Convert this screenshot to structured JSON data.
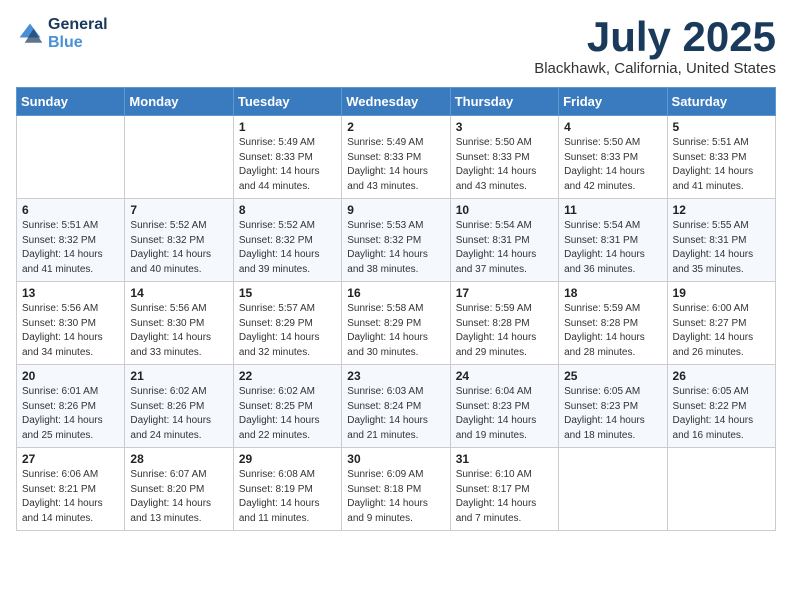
{
  "header": {
    "logo_line1": "General",
    "logo_line2": "Blue",
    "month": "July 2025",
    "location": "Blackhawk, California, United States"
  },
  "weekdays": [
    "Sunday",
    "Monday",
    "Tuesday",
    "Wednesday",
    "Thursday",
    "Friday",
    "Saturday"
  ],
  "weeks": [
    [
      {
        "day": "",
        "info": ""
      },
      {
        "day": "",
        "info": ""
      },
      {
        "day": "1",
        "info": "Sunrise: 5:49 AM\nSunset: 8:33 PM\nDaylight: 14 hours and 44 minutes."
      },
      {
        "day": "2",
        "info": "Sunrise: 5:49 AM\nSunset: 8:33 PM\nDaylight: 14 hours and 43 minutes."
      },
      {
        "day": "3",
        "info": "Sunrise: 5:50 AM\nSunset: 8:33 PM\nDaylight: 14 hours and 43 minutes."
      },
      {
        "day": "4",
        "info": "Sunrise: 5:50 AM\nSunset: 8:33 PM\nDaylight: 14 hours and 42 minutes."
      },
      {
        "day": "5",
        "info": "Sunrise: 5:51 AM\nSunset: 8:33 PM\nDaylight: 14 hours and 41 minutes."
      }
    ],
    [
      {
        "day": "6",
        "info": "Sunrise: 5:51 AM\nSunset: 8:32 PM\nDaylight: 14 hours and 41 minutes."
      },
      {
        "day": "7",
        "info": "Sunrise: 5:52 AM\nSunset: 8:32 PM\nDaylight: 14 hours and 40 minutes."
      },
      {
        "day": "8",
        "info": "Sunrise: 5:52 AM\nSunset: 8:32 PM\nDaylight: 14 hours and 39 minutes."
      },
      {
        "day": "9",
        "info": "Sunrise: 5:53 AM\nSunset: 8:32 PM\nDaylight: 14 hours and 38 minutes."
      },
      {
        "day": "10",
        "info": "Sunrise: 5:54 AM\nSunset: 8:31 PM\nDaylight: 14 hours and 37 minutes."
      },
      {
        "day": "11",
        "info": "Sunrise: 5:54 AM\nSunset: 8:31 PM\nDaylight: 14 hours and 36 minutes."
      },
      {
        "day": "12",
        "info": "Sunrise: 5:55 AM\nSunset: 8:31 PM\nDaylight: 14 hours and 35 minutes."
      }
    ],
    [
      {
        "day": "13",
        "info": "Sunrise: 5:56 AM\nSunset: 8:30 PM\nDaylight: 14 hours and 34 minutes."
      },
      {
        "day": "14",
        "info": "Sunrise: 5:56 AM\nSunset: 8:30 PM\nDaylight: 14 hours and 33 minutes."
      },
      {
        "day": "15",
        "info": "Sunrise: 5:57 AM\nSunset: 8:29 PM\nDaylight: 14 hours and 32 minutes."
      },
      {
        "day": "16",
        "info": "Sunrise: 5:58 AM\nSunset: 8:29 PM\nDaylight: 14 hours and 30 minutes."
      },
      {
        "day": "17",
        "info": "Sunrise: 5:59 AM\nSunset: 8:28 PM\nDaylight: 14 hours and 29 minutes."
      },
      {
        "day": "18",
        "info": "Sunrise: 5:59 AM\nSunset: 8:28 PM\nDaylight: 14 hours and 28 minutes."
      },
      {
        "day": "19",
        "info": "Sunrise: 6:00 AM\nSunset: 8:27 PM\nDaylight: 14 hours and 26 minutes."
      }
    ],
    [
      {
        "day": "20",
        "info": "Sunrise: 6:01 AM\nSunset: 8:26 PM\nDaylight: 14 hours and 25 minutes."
      },
      {
        "day": "21",
        "info": "Sunrise: 6:02 AM\nSunset: 8:26 PM\nDaylight: 14 hours and 24 minutes."
      },
      {
        "day": "22",
        "info": "Sunrise: 6:02 AM\nSunset: 8:25 PM\nDaylight: 14 hours and 22 minutes."
      },
      {
        "day": "23",
        "info": "Sunrise: 6:03 AM\nSunset: 8:24 PM\nDaylight: 14 hours and 21 minutes."
      },
      {
        "day": "24",
        "info": "Sunrise: 6:04 AM\nSunset: 8:23 PM\nDaylight: 14 hours and 19 minutes."
      },
      {
        "day": "25",
        "info": "Sunrise: 6:05 AM\nSunset: 8:23 PM\nDaylight: 14 hours and 18 minutes."
      },
      {
        "day": "26",
        "info": "Sunrise: 6:05 AM\nSunset: 8:22 PM\nDaylight: 14 hours and 16 minutes."
      }
    ],
    [
      {
        "day": "27",
        "info": "Sunrise: 6:06 AM\nSunset: 8:21 PM\nDaylight: 14 hours and 14 minutes."
      },
      {
        "day": "28",
        "info": "Sunrise: 6:07 AM\nSunset: 8:20 PM\nDaylight: 14 hours and 13 minutes."
      },
      {
        "day": "29",
        "info": "Sunrise: 6:08 AM\nSunset: 8:19 PM\nDaylight: 14 hours and 11 minutes."
      },
      {
        "day": "30",
        "info": "Sunrise: 6:09 AM\nSunset: 8:18 PM\nDaylight: 14 hours and 9 minutes."
      },
      {
        "day": "31",
        "info": "Sunrise: 6:10 AM\nSunset: 8:17 PM\nDaylight: 14 hours and 7 minutes."
      },
      {
        "day": "",
        "info": ""
      },
      {
        "day": "",
        "info": ""
      }
    ]
  ]
}
